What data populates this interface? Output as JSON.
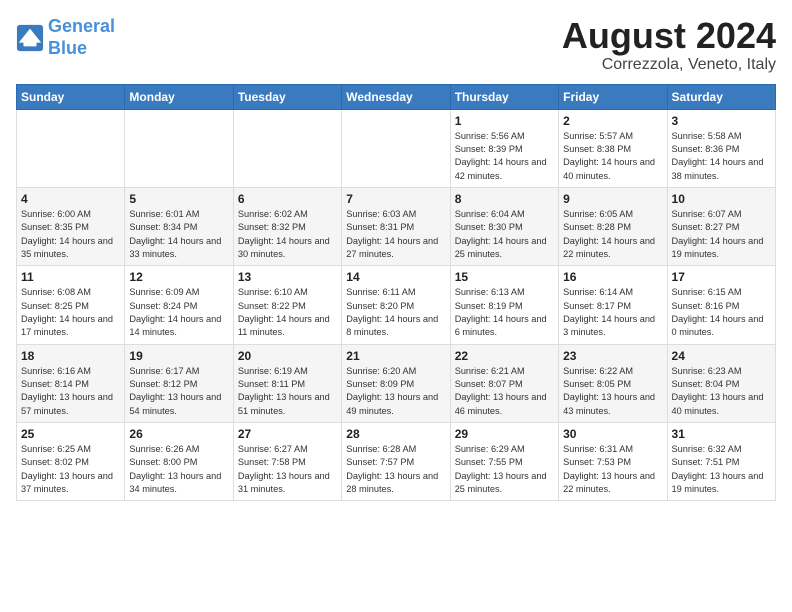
{
  "logo": {
    "line1": "General",
    "line2": "Blue"
  },
  "title": "August 2024",
  "subtitle": "Correzzola, Veneto, Italy",
  "days_of_week": [
    "Sunday",
    "Monday",
    "Tuesday",
    "Wednesday",
    "Thursday",
    "Friday",
    "Saturday"
  ],
  "weeks": [
    [
      {
        "day": "",
        "info": ""
      },
      {
        "day": "",
        "info": ""
      },
      {
        "day": "",
        "info": ""
      },
      {
        "day": "",
        "info": ""
      },
      {
        "day": "1",
        "info": "Sunrise: 5:56 AM\nSunset: 8:39 PM\nDaylight: 14 hours and 42 minutes."
      },
      {
        "day": "2",
        "info": "Sunrise: 5:57 AM\nSunset: 8:38 PM\nDaylight: 14 hours and 40 minutes."
      },
      {
        "day": "3",
        "info": "Sunrise: 5:58 AM\nSunset: 8:36 PM\nDaylight: 14 hours and 38 minutes."
      }
    ],
    [
      {
        "day": "4",
        "info": "Sunrise: 6:00 AM\nSunset: 8:35 PM\nDaylight: 14 hours and 35 minutes."
      },
      {
        "day": "5",
        "info": "Sunrise: 6:01 AM\nSunset: 8:34 PM\nDaylight: 14 hours and 33 minutes."
      },
      {
        "day": "6",
        "info": "Sunrise: 6:02 AM\nSunset: 8:32 PM\nDaylight: 14 hours and 30 minutes."
      },
      {
        "day": "7",
        "info": "Sunrise: 6:03 AM\nSunset: 8:31 PM\nDaylight: 14 hours and 27 minutes."
      },
      {
        "day": "8",
        "info": "Sunrise: 6:04 AM\nSunset: 8:30 PM\nDaylight: 14 hours and 25 minutes."
      },
      {
        "day": "9",
        "info": "Sunrise: 6:05 AM\nSunset: 8:28 PM\nDaylight: 14 hours and 22 minutes."
      },
      {
        "day": "10",
        "info": "Sunrise: 6:07 AM\nSunset: 8:27 PM\nDaylight: 14 hours and 19 minutes."
      }
    ],
    [
      {
        "day": "11",
        "info": "Sunrise: 6:08 AM\nSunset: 8:25 PM\nDaylight: 14 hours and 17 minutes."
      },
      {
        "day": "12",
        "info": "Sunrise: 6:09 AM\nSunset: 8:24 PM\nDaylight: 14 hours and 14 minutes."
      },
      {
        "day": "13",
        "info": "Sunrise: 6:10 AM\nSunset: 8:22 PM\nDaylight: 14 hours and 11 minutes."
      },
      {
        "day": "14",
        "info": "Sunrise: 6:11 AM\nSunset: 8:20 PM\nDaylight: 14 hours and 8 minutes."
      },
      {
        "day": "15",
        "info": "Sunrise: 6:13 AM\nSunset: 8:19 PM\nDaylight: 14 hours and 6 minutes."
      },
      {
        "day": "16",
        "info": "Sunrise: 6:14 AM\nSunset: 8:17 PM\nDaylight: 14 hours and 3 minutes."
      },
      {
        "day": "17",
        "info": "Sunrise: 6:15 AM\nSunset: 8:16 PM\nDaylight: 14 hours and 0 minutes."
      }
    ],
    [
      {
        "day": "18",
        "info": "Sunrise: 6:16 AM\nSunset: 8:14 PM\nDaylight: 13 hours and 57 minutes."
      },
      {
        "day": "19",
        "info": "Sunrise: 6:17 AM\nSunset: 8:12 PM\nDaylight: 13 hours and 54 minutes."
      },
      {
        "day": "20",
        "info": "Sunrise: 6:19 AM\nSunset: 8:11 PM\nDaylight: 13 hours and 51 minutes."
      },
      {
        "day": "21",
        "info": "Sunrise: 6:20 AM\nSunset: 8:09 PM\nDaylight: 13 hours and 49 minutes."
      },
      {
        "day": "22",
        "info": "Sunrise: 6:21 AM\nSunset: 8:07 PM\nDaylight: 13 hours and 46 minutes."
      },
      {
        "day": "23",
        "info": "Sunrise: 6:22 AM\nSunset: 8:05 PM\nDaylight: 13 hours and 43 minutes."
      },
      {
        "day": "24",
        "info": "Sunrise: 6:23 AM\nSunset: 8:04 PM\nDaylight: 13 hours and 40 minutes."
      }
    ],
    [
      {
        "day": "25",
        "info": "Sunrise: 6:25 AM\nSunset: 8:02 PM\nDaylight: 13 hours and 37 minutes."
      },
      {
        "day": "26",
        "info": "Sunrise: 6:26 AM\nSunset: 8:00 PM\nDaylight: 13 hours and 34 minutes."
      },
      {
        "day": "27",
        "info": "Sunrise: 6:27 AM\nSunset: 7:58 PM\nDaylight: 13 hours and 31 minutes."
      },
      {
        "day": "28",
        "info": "Sunrise: 6:28 AM\nSunset: 7:57 PM\nDaylight: 13 hours and 28 minutes."
      },
      {
        "day": "29",
        "info": "Sunrise: 6:29 AM\nSunset: 7:55 PM\nDaylight: 13 hours and 25 minutes."
      },
      {
        "day": "30",
        "info": "Sunrise: 6:31 AM\nSunset: 7:53 PM\nDaylight: 13 hours and 22 minutes."
      },
      {
        "day": "31",
        "info": "Sunrise: 6:32 AM\nSunset: 7:51 PM\nDaylight: 13 hours and 19 minutes."
      }
    ]
  ]
}
